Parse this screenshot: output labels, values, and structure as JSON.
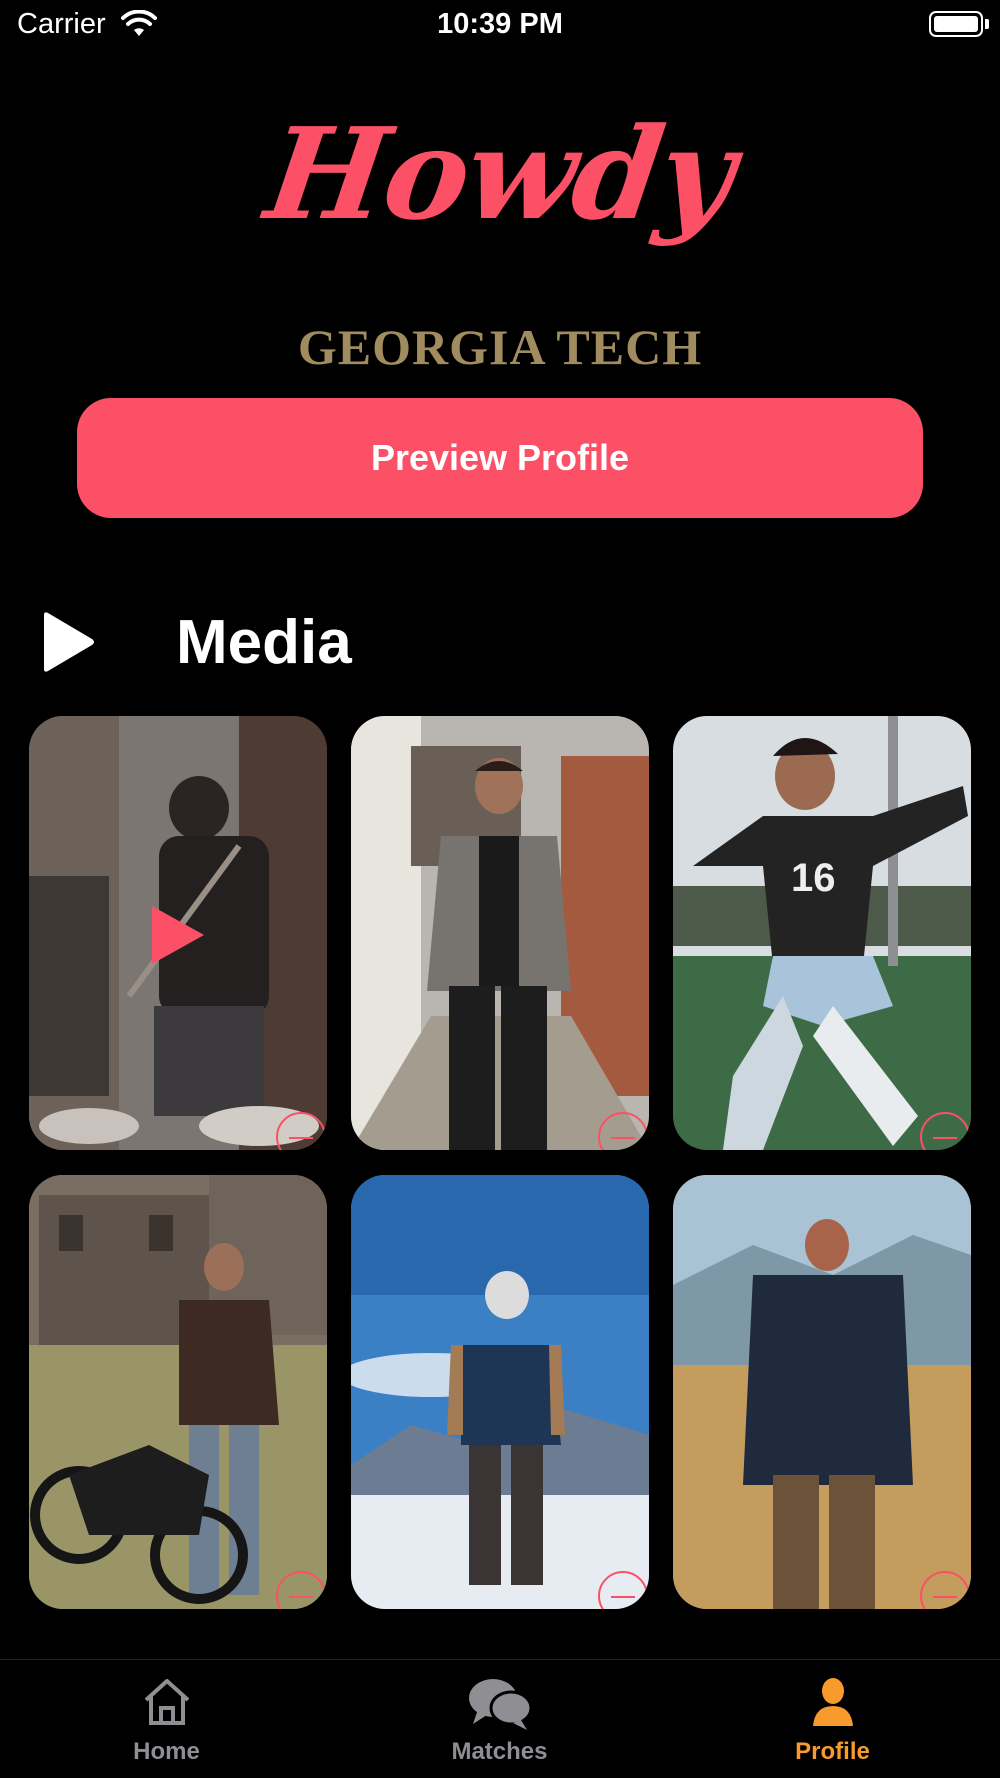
{
  "status_bar": {
    "carrier": "Carrier",
    "time": "10:39 PM"
  },
  "brand": {
    "logo": "Howdy",
    "school": "GEORGIA TECH"
  },
  "preview_button": {
    "label": "Preview Profile"
  },
  "media": {
    "title": "Media"
  },
  "media_tiles": [
    {
      "subject": "musician playing guitar (video)",
      "is_video": true
    },
    {
      "subject": "man in grey blazer in alley"
    },
    {
      "subject": "soccer player number 16"
    },
    {
      "subject": "man with motorcycle near castle"
    },
    {
      "subject": "skier on snowy mountain"
    },
    {
      "subject": "man in jacket in wheat field"
    }
  ],
  "tabs": [
    {
      "label": "Home",
      "icon": "home-icon",
      "active": false
    },
    {
      "label": "Matches",
      "icon": "chat-bubbles-icon",
      "active": false
    },
    {
      "label": "Profile",
      "icon": "person-icon",
      "active": true
    }
  ],
  "colors": {
    "accent": "#fc5067",
    "gold": "#a08c5e",
    "tab_active": "#f99a2d",
    "tab_inactive": "#8e8e93",
    "background": "#000000"
  }
}
